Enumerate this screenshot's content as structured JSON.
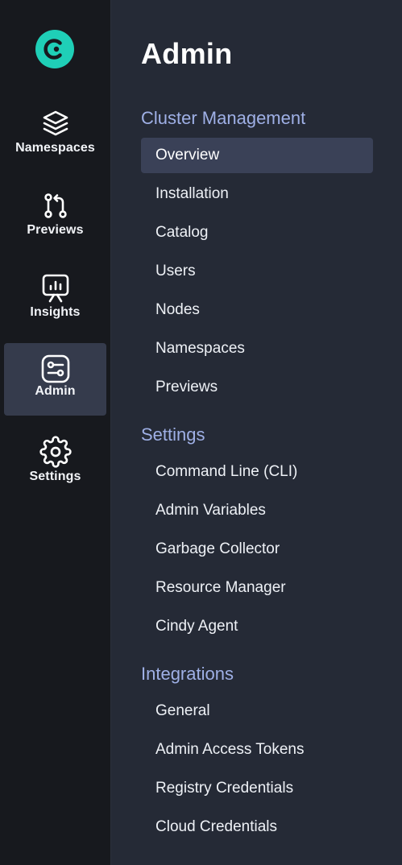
{
  "rail": {
    "logo_icon": "app-logo-icon",
    "items": [
      {
        "label": "Namespaces",
        "icon": "layers-icon",
        "active": false
      },
      {
        "label": "Previews",
        "icon": "pull-request-icon",
        "active": false
      },
      {
        "label": "Insights",
        "icon": "presentation-chart-icon",
        "active": false
      },
      {
        "label": "Admin",
        "icon": "sliders-icon",
        "active": true
      },
      {
        "label": "Settings",
        "icon": "gear-icon",
        "active": false
      }
    ]
  },
  "panel": {
    "title": "Admin",
    "sections": [
      {
        "title": "Cluster Management",
        "items": [
          "Overview",
          "Installation",
          "Catalog",
          "Users",
          "Nodes",
          "Namespaces",
          "Previews"
        ]
      },
      {
        "title": "Settings",
        "items": [
          "Command Line (CLI)",
          "Admin Variables",
          "Garbage Collector",
          "Resource Manager",
          "Cindy Agent"
        ]
      },
      {
        "title": "Integrations",
        "items": [
          "General",
          "Admin Access Tokens",
          "Registry Credentials",
          "Cloud Credentials"
        ]
      }
    ],
    "active_item": "Overview"
  },
  "colors": {
    "rail_bg": "#17191e",
    "panel_bg": "#252a36",
    "active_bg": "#3a4157",
    "section_title": "#9fb0e6",
    "brand": "#1fcfb7"
  }
}
